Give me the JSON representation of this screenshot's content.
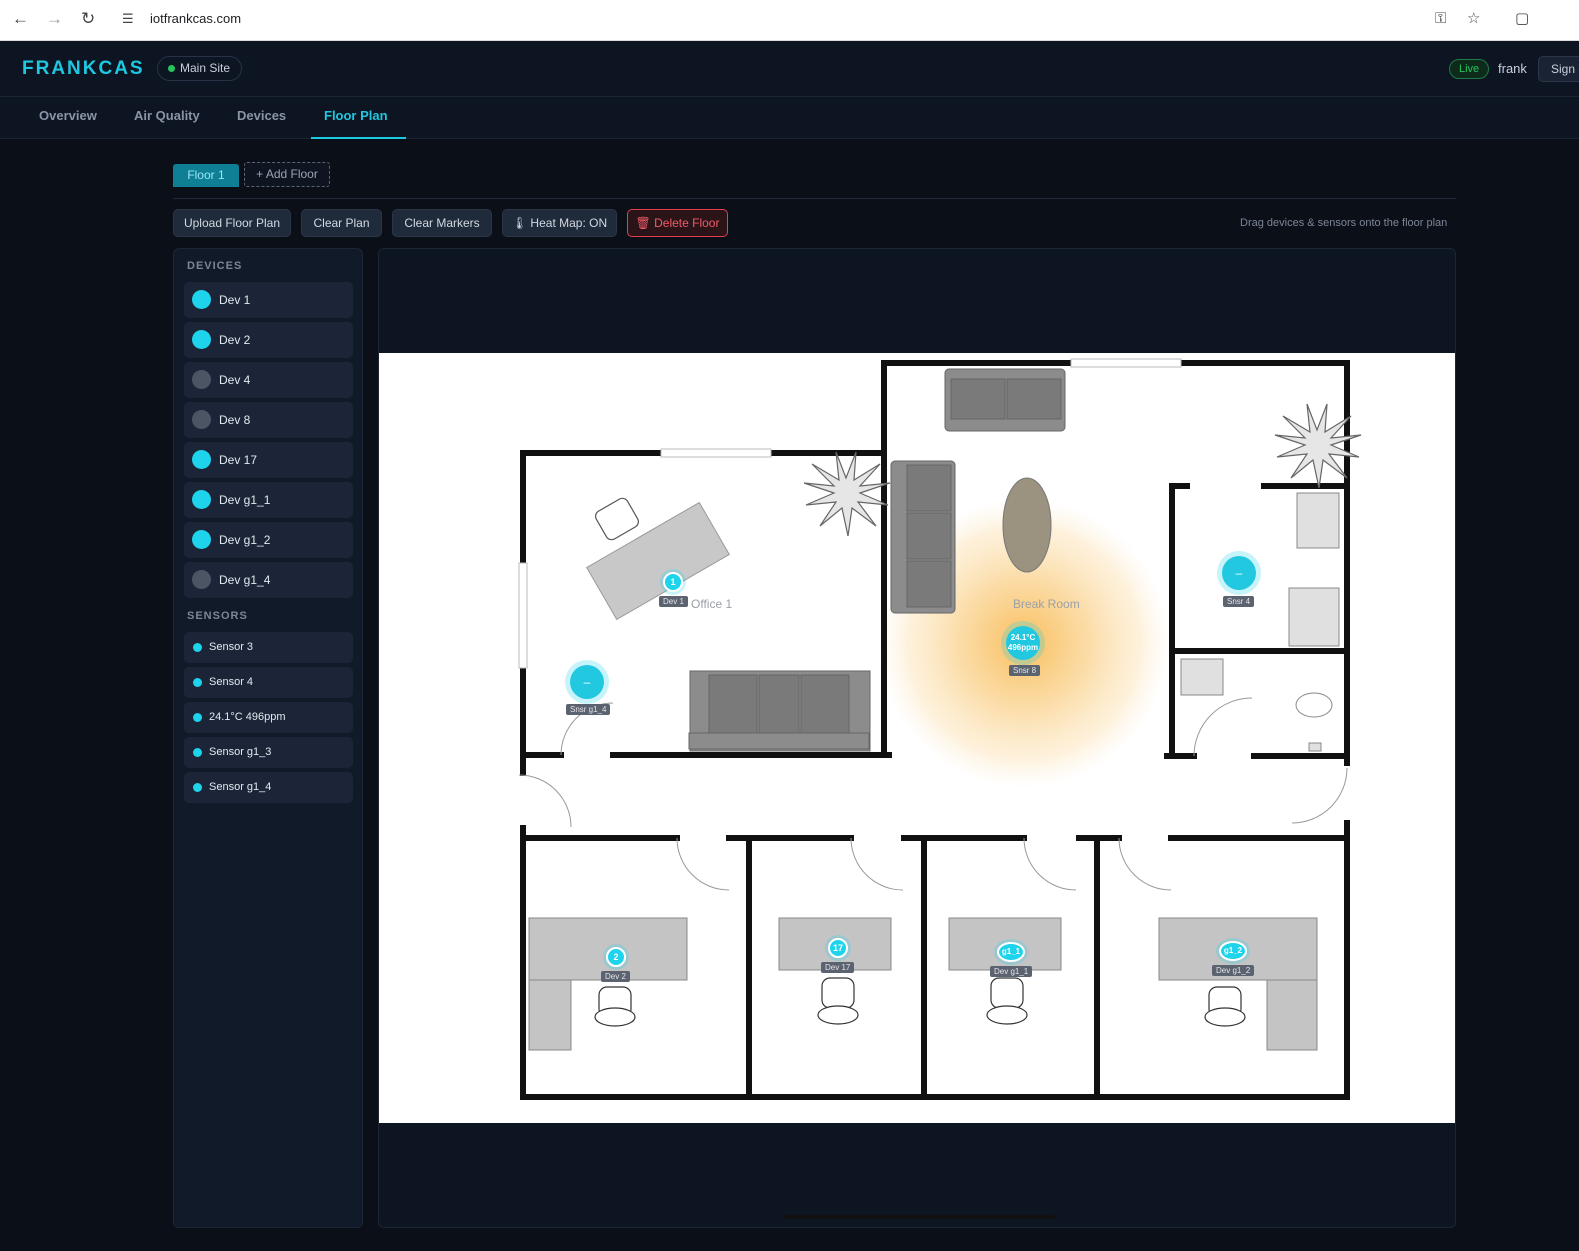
{
  "browser": {
    "url": "iotfrankcas.com",
    "icons": [
      "back-arrow-icon",
      "forward-arrow-icon",
      "reload-icon",
      "site-settings-icon",
      "key-icon",
      "star-icon",
      "extensions-icon"
    ]
  },
  "header": {
    "logo": "FRANKCAS",
    "site": "Main Site",
    "live": "Live",
    "user": "frank",
    "sign_label": "Sign out"
  },
  "nav": {
    "tabs": [
      {
        "label": "Overview"
      },
      {
        "label": "Air Quality"
      },
      {
        "label": "Devices"
      },
      {
        "label": "Floor Plan",
        "active": true
      }
    ]
  },
  "floors": {
    "tabs": [
      {
        "label": "Floor 1"
      }
    ],
    "add_label": "+ Add Floor"
  },
  "toolbar": {
    "upload": "Upload Floor Plan",
    "clear_plan": "Clear Plan",
    "clear_markers": "Clear Markers",
    "heatmap": "🌡 Heat Map: ON",
    "delete": "🗑 Delete Floor",
    "hint": "Drag devices & sensors onto the floor plan"
  },
  "sidebar": {
    "devices_title": "DEVICES",
    "devices": [
      {
        "label": "Dev 1",
        "online": true
      },
      {
        "label": "Dev 2",
        "online": true
      },
      {
        "label": "Dev 4",
        "online": false
      },
      {
        "label": "Dev 8",
        "online": false
      },
      {
        "label": "Dev 17",
        "online": true
      },
      {
        "label": "Dev g1_1",
        "online": true
      },
      {
        "label": "Dev g1_2",
        "online": true
      },
      {
        "label": "Dev g1_4",
        "online": false
      }
    ],
    "sensors_title": "SENSORS",
    "sensors": [
      {
        "label": "Sensor 3"
      },
      {
        "label": "Sensor 4"
      },
      {
        "label": "24.1°C 496ppm"
      },
      {
        "label": "Sensor g1_3"
      },
      {
        "label": "Sensor g1_4"
      }
    ]
  },
  "plan": {
    "rooms": {
      "office": "Office 1",
      "break": "Break Room"
    },
    "device_markers": [
      {
        "badge": "1",
        "label": "Dev 1"
      },
      {
        "badge": "2",
        "label": "Dev 2"
      },
      {
        "badge": "17",
        "label": "Dev 17"
      },
      {
        "badge": "g1_1",
        "label": "Dev g1_1"
      },
      {
        "badge": "g1_2",
        "label": "Dev g1_2"
      }
    ],
    "sensor_markers": [
      {
        "badge": "–",
        "label": "Snsr g1_4"
      },
      {
        "badge": "–",
        "label": "Snsr 4"
      },
      {
        "badge": "24.1°C 496ppm",
        "label": "Snsr 8"
      }
    ]
  },
  "colors": {
    "accent": "#1ec8e0",
    "danger": "#f05a68",
    "live": "#22c55e",
    "heat": "#f8b340"
  }
}
